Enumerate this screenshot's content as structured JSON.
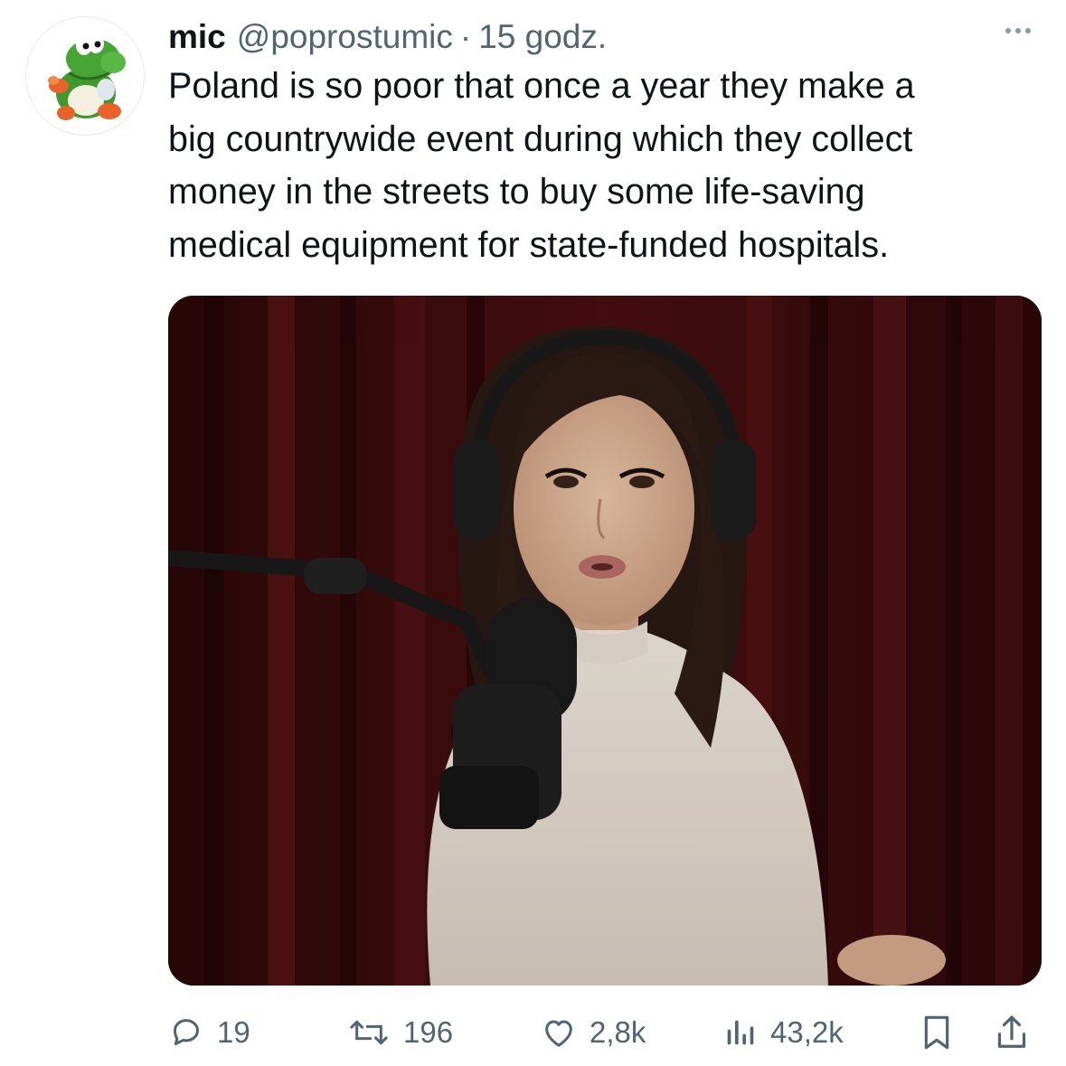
{
  "tweet": {
    "author_name": "mic",
    "handle": "@poprostumic",
    "separator": "·",
    "time": "15 godz.",
    "text": "Poland is so poor that once a year they make a\nbig countrywide event during which they collect\nmoney in the streets to buy some life-saving\nmedical equipment for state-funded hospitals.",
    "media": {
      "kind": "photo"
    }
  },
  "actions": {
    "replies": "19",
    "reposts": "196",
    "likes": "2,8k",
    "views": "43,2k"
  },
  "icons": {
    "more": "more-dots-icon",
    "reply": "reply-bubble-icon",
    "repost": "repost-arrows-icon",
    "like": "heart-icon",
    "views": "bar-chart-icon",
    "bookmark": "bookmark-icon",
    "share": "share-upload-icon"
  },
  "colors": {
    "text": "#0f1419",
    "secondary": "#536471",
    "border": "#e6e9ec"
  }
}
